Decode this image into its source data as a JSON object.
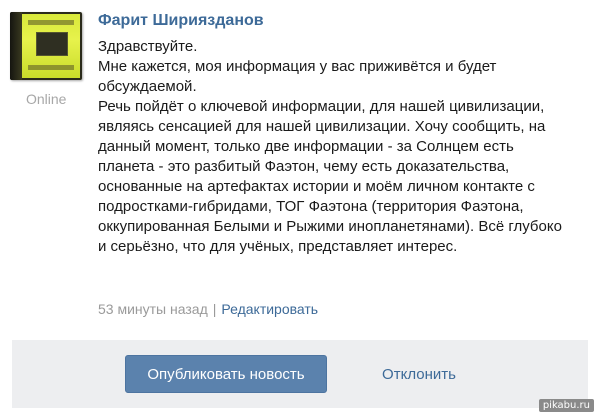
{
  "post": {
    "author": "Фарит Шириязданов",
    "status": "Online",
    "avatar_icon": "book-cover-avatar",
    "message_lines": [
      "Здравствуйте.",
      "Мне кажется, моя информация у вас приживётся и будет обсуждаемой.",
      "Речь пойдёт о ключевой информации, для нашей цивилизации, являясь сенсацией для нашей цивилизации. Хочу сообщить, на данный момент, только две информации - за Солнцем есть планета - это разбитый Фаэтон, чему есть доказательства, основанные на артефактах истории и моём личном контакте с подростками-гибридами, ТОГ Фаэтона (территория Фаэтона, оккупированная Белыми и Рыжими инопланетянами). Всё глубоко и серьёзно, что для учёных, представляет интерес."
    ],
    "timestamp": "53 минуты назад",
    "separator": "|",
    "edit_label": "Редактировать"
  },
  "actions": {
    "publish_label": "Опубликовать новость",
    "reject_label": "Отклонить"
  },
  "watermark": "pikabu.ru",
  "colors": {
    "link": "#3d6a98",
    "button": "#5b82ad",
    "footer_bg": "#edeef0",
    "muted": "#9a9a9a"
  }
}
